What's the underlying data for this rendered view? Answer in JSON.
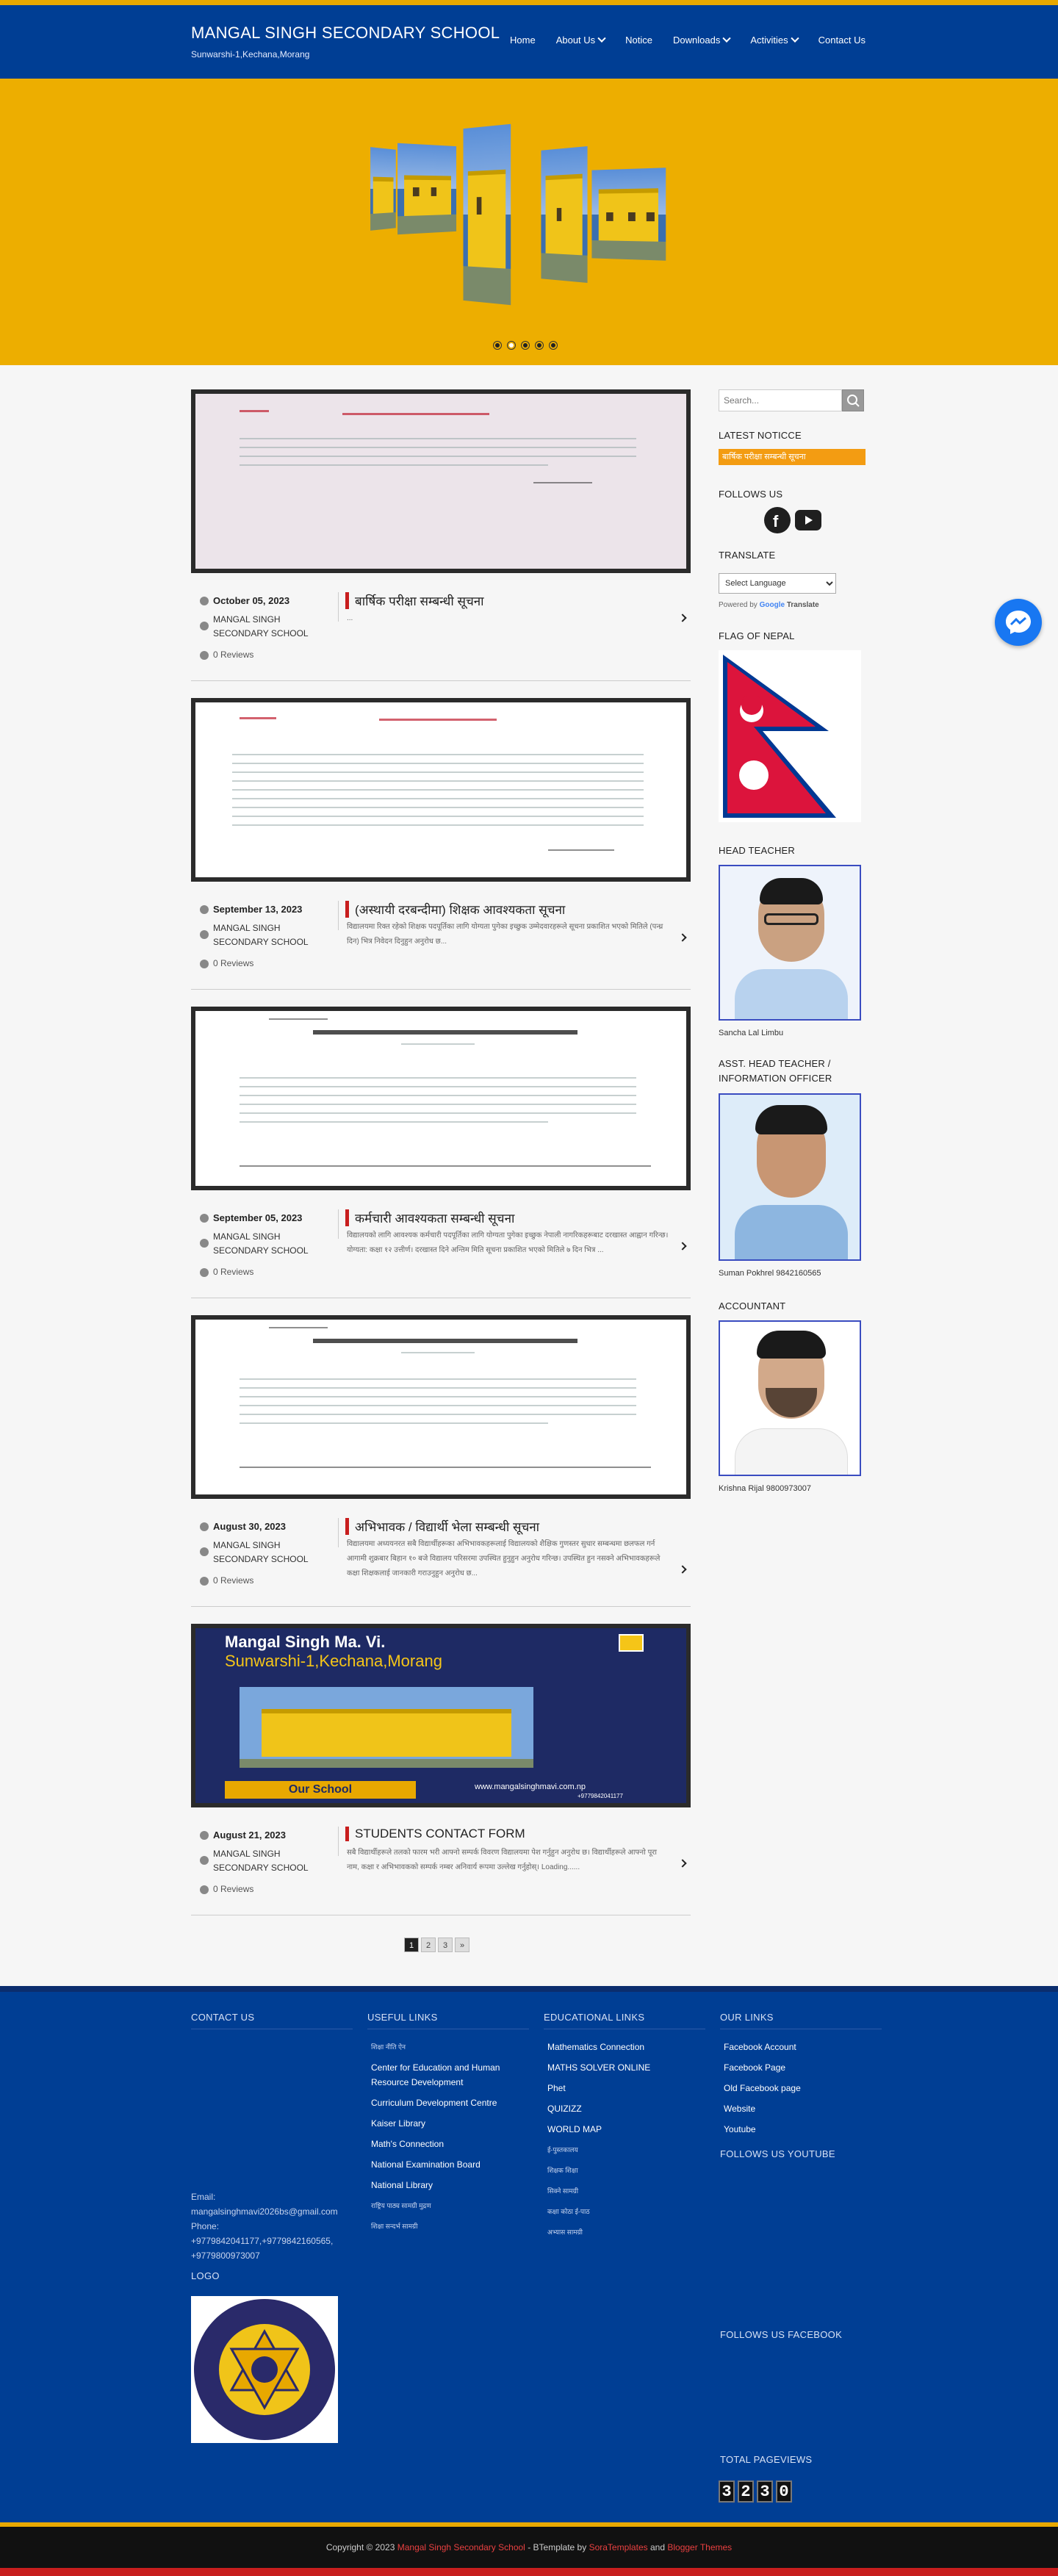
{
  "header": {
    "title": "MANGAL SINGH SECONDARY SCHOOL",
    "subtitle": "Sunwarshi-1,Kechana,Morang",
    "nav": [
      {
        "label": "Home",
        "dropdown": false
      },
      {
        "label": "About Us",
        "dropdown": true
      },
      {
        "label": "Notice",
        "dropdown": false
      },
      {
        "label": "Downloads",
        "dropdown": true
      },
      {
        "label": "Activities",
        "dropdown": true
      },
      {
        "label": "Contact Us",
        "dropdown": false
      }
    ]
  },
  "slider": {
    "slide_count": 5,
    "active_slide": 1
  },
  "posts": [
    {
      "date": "October 05, 2023",
      "author": "MANGAL SINGH SECONDARY SCHOOL",
      "reviews": "0 Reviews",
      "title": "बार्षिक परीक्षा सम्बन्धी सूचना",
      "excerpt": "..."
    },
    {
      "date": "September 13, 2023",
      "author": "MANGAL SINGH SECONDARY SCHOOL",
      "reviews": "0 Reviews",
      "title": "(अस्थायी दरबन्दीमा) शिक्षक आवश्यकता सूचना",
      "excerpt": "विद्यालयमा रिक्त रहेको शिक्षक पदपूर्तिका लागि योग्यता पुगेका इच्छुक उम्मेदवारहरूले सूचना प्रकाशित भएको मितिले (पन्ध्र दिन) भित्र निवेदन दिनुहुन अनुरोध छ..."
    },
    {
      "date": "September 05, 2023",
      "author": "MANGAL SINGH SECONDARY SCHOOL",
      "reviews": "0 Reviews",
      "title": "कर्मचारी आवश्यकता सम्बन्धी सूचना",
      "excerpt": "विद्यालयको लागि आवश्यक कर्मचारी पदपूर्तिका लागि योग्यता पुगेका इच्छुक नेपाली नागरिकहरूबाट दरखास्त आह्वान गरिन्छ। योग्यता: कक्षा १२ उत्तीर्ण। दरखास्त दिने अन्तिम मिति सूचना प्रकाशित भएको मितिले ७ दिन भित्र ..."
    },
    {
      "date": "August 30, 2023",
      "author": "MANGAL SINGH SECONDARY SCHOOL",
      "reviews": "0 Reviews",
      "title": "अभिभावक / विद्यार्थी भेला सम्बन्धी सूचना",
      "excerpt": "विद्यालयमा अध्ययनरत सबै विद्यार्थीहरूका अभिभावकहरूलाई विद्यालयको शैक्षिक गुणस्तर सुधार सम्बन्धमा छलफल गर्न आगामी शुक्रबार बिहान १० बजे विद्यालय परिसरमा उपस्थित हुनुहुन अनुरोध गरिन्छ। उपस्थित हुन नसक्ने अभिभावकहरूले कक्षा शिक्षकलाई जानकारी गराउनुहुन अनुरोध छ..."
    },
    {
      "date": "August 21, 2023",
      "author": "MANGAL SINGH SECONDARY SCHOOL",
      "reviews": "0 Reviews",
      "title": "STUDENTS CONTACT FORM",
      "excerpt": "सबै विद्यार्थीहरूले तलको फारम भरी आफ्नो सम्पर्क विवरण विद्यालयमा पेश गर्नुहुन अनुरोध छ। विद्यार्थीहरूले आफ्नो पूरा नाम, कक्षा र अभिभावकको सम्पर्क नम्बर अनिवार्य रूपमा उल्लेख गर्नुहोस्। Loading......"
    }
  ],
  "featured_banner": {
    "line1": "Mangal Singh Ma. Vi.",
    "line2": "Sunwarshi-1,Kechana,Morang",
    "tag": "Our School",
    "url": "www.mangalsinghmavi.com.np",
    "phone": "+9779842041177"
  },
  "pagination": [
    "1",
    "2",
    "3",
    "»"
  ],
  "pagination_active": "1",
  "sidebar": {
    "search_placeholder": "Search...",
    "latest_notice_heading": "LATEST NOTICCE",
    "latest_notice_item": "बार्षिक परीक्षा सम्बन्धी सूचना",
    "follow_heading": "FOLLOWS US",
    "translate_heading": "TRANSLATE",
    "select_language": "Select Language",
    "powered_by": "Powered by",
    "google": "Google",
    "translate_word": "Translate",
    "flag_heading": "FLAG OF NEPAL",
    "head_teacher_heading": "HEAD TEACHER",
    "head_teacher_name": "Sancha Lal Limbu",
    "asst_heading": "ASST. HEAD TEACHER / INFORMATION OFFICER",
    "asst_name": "Suman Pokhrel 9842160565",
    "accountant_heading": "ACCOUNTANT",
    "accountant_name": "Krishna Rijal 9800973007"
  },
  "footer": {
    "contact_heading": "CONTACT US",
    "email_label": "Email:",
    "email": "mangalsinghmavi2026bs@gmail.com",
    "phone_label": "Phone:",
    "phones": "+9779842041177,+9779842160565, +9779800973007",
    "logo_heading": "LOGO",
    "useful_heading": "USEFUL LINKS",
    "useful_links": [
      "शिक्षा नीति ऐन",
      "Center for Education and Human Resource Development",
      "Curriculum Development Centre",
      "Kaiser Library",
      "Math's Connection",
      "National Examination Board",
      "National Library",
      "राष्ट्रिय पाठ्य सामग्री मुद्रण",
      "शिक्षा सन्दर्भ सामग्री"
    ],
    "edu_heading": "EDUCATIONAL LINKS",
    "edu_links": [
      "Mathematics Connection",
      "MATHS SOLVER ONLINE",
      "Phet",
      "QUIZIZZ",
      "WORLD MAP",
      "ई-पुस्तकालय",
      "शिक्षक शिक्षा",
      "सिक्ने सामग्री",
      "कक्षा कोठा ई-पाठ",
      "अभ्यास सामग्री"
    ],
    "our_heading": "OUR LINKS",
    "our_links": [
      "Facebook Account",
      "Facebook Page",
      "Old Facebook page",
      "Website",
      "Youtube"
    ],
    "yt_heading": "FOLLOWS US YOUTUBE",
    "fb_heading": "FOLLOWS US FACEBOOK",
    "pageviews_heading": "TOTAL PAGEVIEWS",
    "pageviews_digits": [
      "3",
      "2",
      "3",
      "0"
    ]
  },
  "bottom": {
    "copyright_prefix": "Copyright © 2023",
    "site_name": "Mangal Singh Secondary School",
    "template_text": "- BTemplate by",
    "author": "SoraTemplates",
    "and": "and",
    "blogger": "Blogger Themes"
  },
  "colors": {
    "header_blue": "#003e94",
    "slider_yellow": "#edae00",
    "accent_red": "#c81e1e",
    "notice_orange": "#f39c12"
  }
}
